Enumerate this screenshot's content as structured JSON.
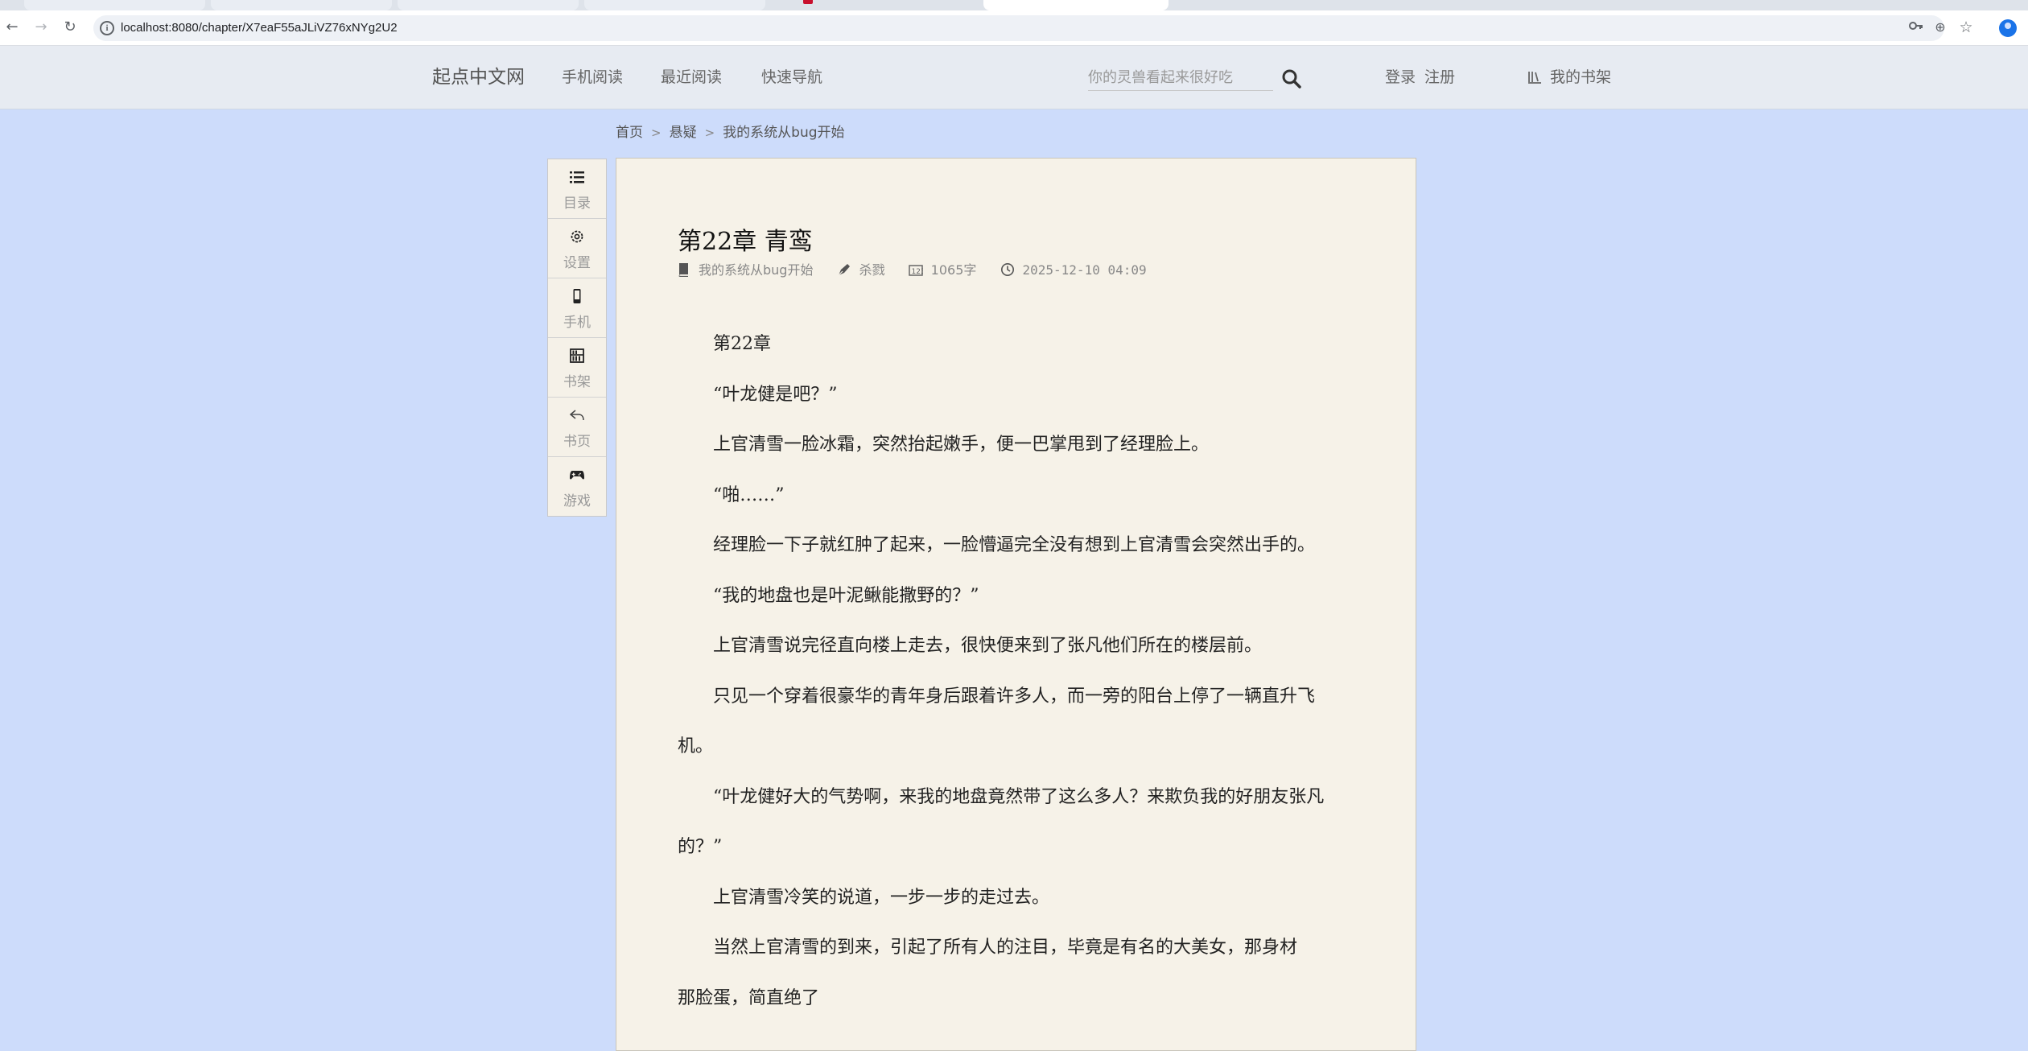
{
  "browser": {
    "url": "localhost:8080/chapter/X7eaF55aJLiVZ76xNYg2U2",
    "info_glyph": "i",
    "back_glyph": "←",
    "forward_glyph": "→",
    "reload_glyph": "↻",
    "zoom_glyph": "⊕",
    "star_glyph": "☆"
  },
  "header": {
    "logo": "起点中文网",
    "nav": [
      "手机阅读",
      "最近阅读",
      "快速导航"
    ],
    "search_placeholder": "你的灵兽看起来很好吃",
    "login": "登录",
    "register": "注册",
    "bookshelf": "我的书架"
  },
  "breadcrumb": {
    "home": "首页",
    "category": "悬疑",
    "book": "我的系统从bug开始",
    "separator": ">"
  },
  "sidebar": [
    {
      "label": "目录",
      "icon": "list-icon"
    },
    {
      "label": "设置",
      "icon": "gear-icon"
    },
    {
      "label": "手机",
      "icon": "phone-icon"
    },
    {
      "label": "书架",
      "icon": "bookshelf-icon"
    },
    {
      "label": "书页",
      "icon": "back-arrow-icon"
    },
    {
      "label": "游戏",
      "icon": "gamepad-icon"
    }
  ],
  "chapter": {
    "title": "第22章 青鸾",
    "book_name": "我的系统从bug开始",
    "author": "杀戮",
    "word_count": "1065字",
    "updated": "2025-12-10 04:09",
    "paragraphs": [
      "第22章",
      "“叶龙健是吧？”",
      "上官清雪一脸冰霜，突然抬起嫩手，便一巴掌甩到了经理脸上。",
      "“啪……”",
      "经理脸一下子就红肿了起来，一脸懵逼完全没有想到上官清雪会突然出手的。",
      "“我的地盘也是叶泥鳅能撒野的？”",
      "上官清雪说完径直向楼上走去，很快便来到了张凡他们所在的楼层前。",
      "只见一个穿着很豪华的青年身后跟着许多人，而一旁的阳台上停了一辆直升飞机。",
      "“叶龙健好大的气势啊，来我的地盘竟然带了这么多人？来欺负我的好朋友张凡的？”",
      "上官清雪冷笑的说道，一步一步的走过去。",
      "当然上官清雪的到来，引起了所有人的注目，毕竟是有名的大美女，那身材",
      "那脸蛋，简直绝了"
    ]
  },
  "colors": {
    "page_bg": "#cddcfb",
    "reader_bg": "#f6f2e8",
    "header_bg": "#e7ebf2"
  }
}
